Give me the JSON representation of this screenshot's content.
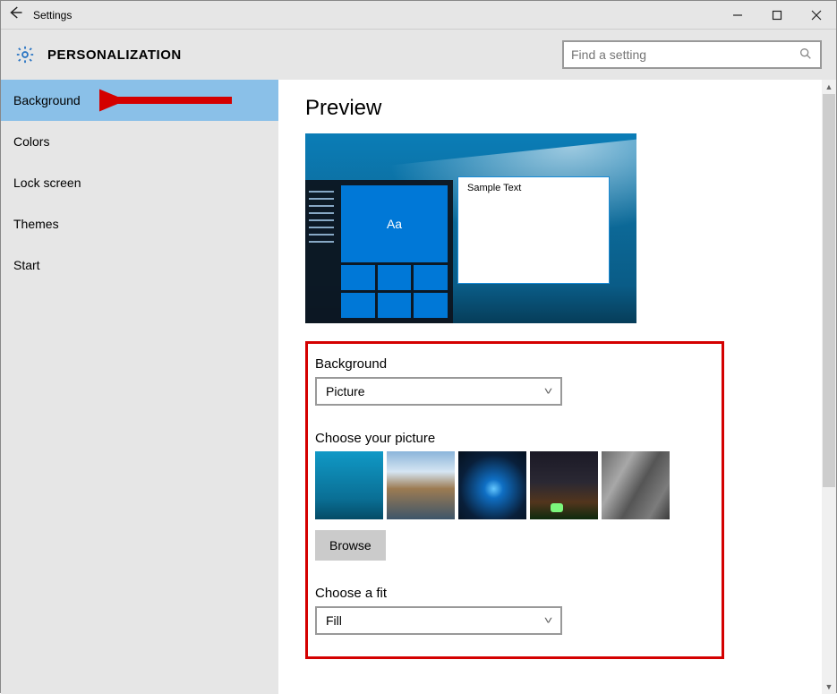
{
  "window": {
    "title": "Settings"
  },
  "header": {
    "title": "PERSONALIZATION"
  },
  "search": {
    "placeholder": "Find a setting"
  },
  "sidebar": {
    "items": [
      {
        "label": "Background",
        "active": true
      },
      {
        "label": "Colors"
      },
      {
        "label": "Lock screen"
      },
      {
        "label": "Themes"
      },
      {
        "label": "Start"
      }
    ]
  },
  "main": {
    "preview_heading": "Preview",
    "preview_tile_text": "Aa",
    "preview_sample_window": "Sample Text",
    "background_label": "Background",
    "background_value": "Picture",
    "choose_picture_label": "Choose your picture",
    "browse_label": "Browse",
    "choose_fit_label": "Choose a fit",
    "fit_value": "Fill"
  }
}
